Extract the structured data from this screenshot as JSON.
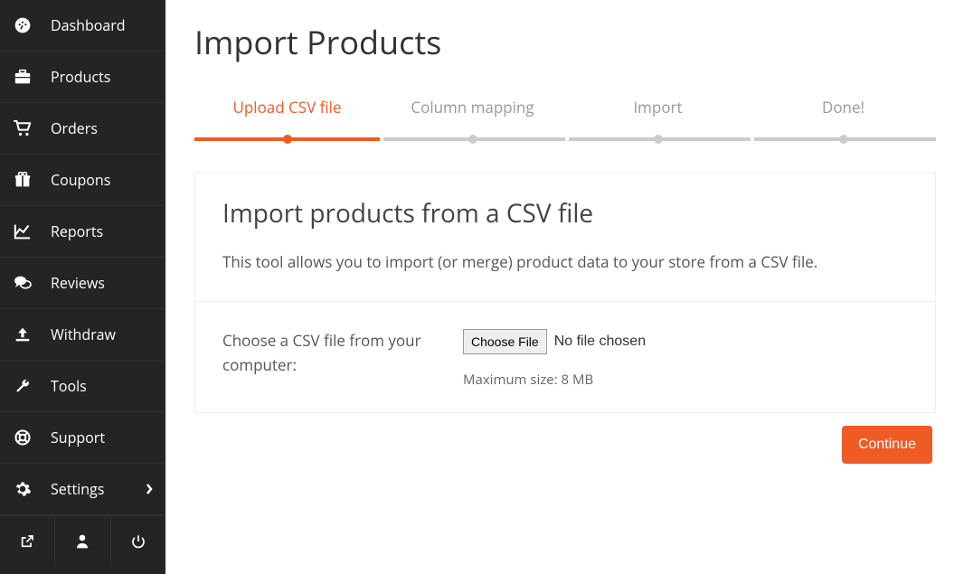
{
  "sidebar": {
    "items": [
      {
        "label": "Dashboard"
      },
      {
        "label": "Products"
      },
      {
        "label": "Orders"
      },
      {
        "label": "Coupons"
      },
      {
        "label": "Reports"
      },
      {
        "label": "Reviews"
      },
      {
        "label": "Withdraw"
      },
      {
        "label": "Tools"
      },
      {
        "label": "Support"
      },
      {
        "label": "Settings"
      }
    ]
  },
  "page": {
    "title": "Import Products"
  },
  "stepper": {
    "steps": [
      {
        "label": "Upload CSV file"
      },
      {
        "label": "Column mapping"
      },
      {
        "label": "Import"
      },
      {
        "label": "Done!"
      }
    ]
  },
  "card": {
    "title": "Import products from a CSV file",
    "description": "This tool allows you to import (or merge) product data to your store from a CSV file.",
    "file_label": "Choose a CSV file from your computer:",
    "file_button": "Choose File",
    "file_status": "No file chosen",
    "hint": "Maximum size: 8 MB"
  },
  "actions": {
    "continue": "Continue"
  }
}
